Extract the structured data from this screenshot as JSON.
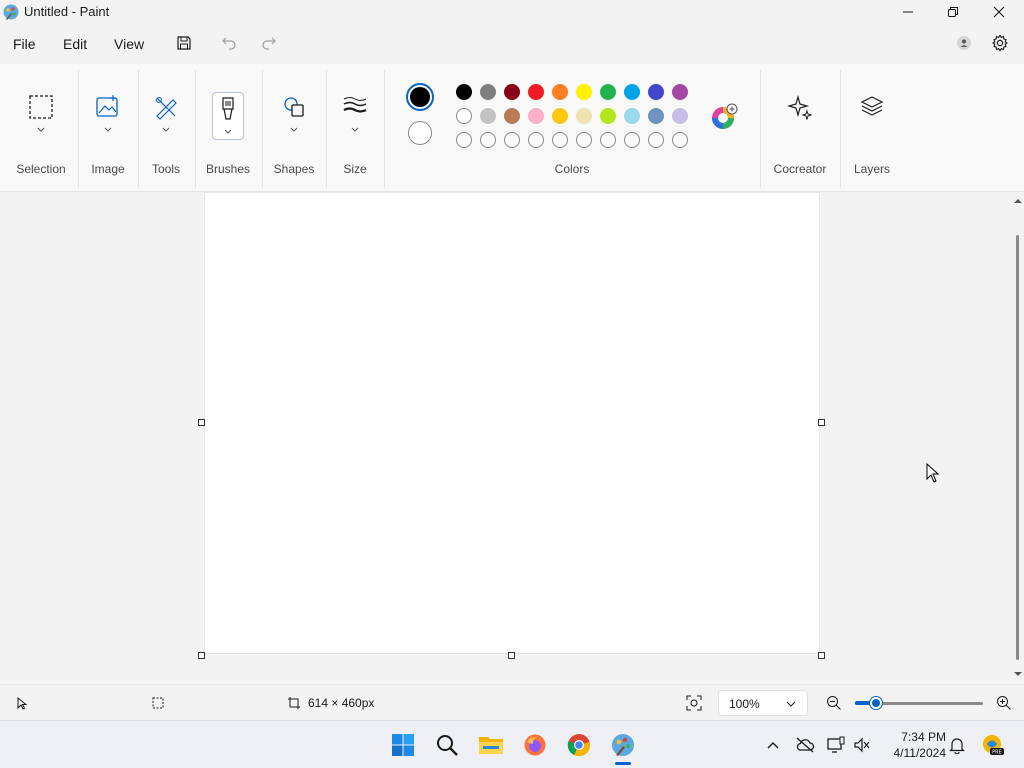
{
  "window": {
    "title": "Untitled - Paint",
    "minimize_icon": "minimize-icon",
    "maximize_icon": "restore-icon",
    "close_icon": "close-icon"
  },
  "menu": {
    "items": [
      "File",
      "Edit",
      "View"
    ],
    "save_icon": "save-icon",
    "undo_icon": "undo-icon",
    "redo_icon": "redo-icon",
    "account_icon": "account-icon",
    "settings_icon": "gear-icon"
  },
  "ribbon": {
    "groups": [
      {
        "label": "Selection",
        "icon": "selection-icon"
      },
      {
        "label": "Image",
        "icon": "image-icon"
      },
      {
        "label": "Tools",
        "icon": "tools-icon"
      },
      {
        "label": "Brushes",
        "icon": "brush-icon"
      },
      {
        "label": "Shapes",
        "icon": "shapes-icon"
      },
      {
        "label": "Size",
        "icon": "size-icon"
      },
      {
        "label": "Colors",
        "icon": "palette"
      },
      {
        "label": "Cocreator",
        "icon": "sparkle-icon"
      },
      {
        "label": "Layers",
        "icon": "layers-icon"
      }
    ],
    "colors": {
      "primary": "#000000",
      "secondary": "#ffffff",
      "row1": [
        "#000000",
        "#7f7f7f",
        "#880015",
        "#ed1c24",
        "#ff7f27",
        "#fff200",
        "#22b14c",
        "#00a2e8",
        "#3f48cc",
        "#a349a4"
      ],
      "row2": [
        "#ffffff",
        "#c3c3c3",
        "#b97a57",
        "#ffaec9",
        "#ffc90e",
        "#efe4b0",
        "#b5e61d",
        "#99d9ea",
        "#7092be",
        "#c8bfe7"
      ],
      "row3_empty_count": 10
    }
  },
  "canvas": {
    "background": "#ffffff"
  },
  "status": {
    "size_text": "614 × 460px",
    "zoom": "100%"
  },
  "taskbar": {
    "time": "7:34 PM",
    "date": "4/11/2024",
    "apps": [
      "windows-start-icon",
      "search-icon",
      "file-explorer-icon",
      "firefox-icon",
      "chrome-icon",
      "paint-icon"
    ]
  }
}
